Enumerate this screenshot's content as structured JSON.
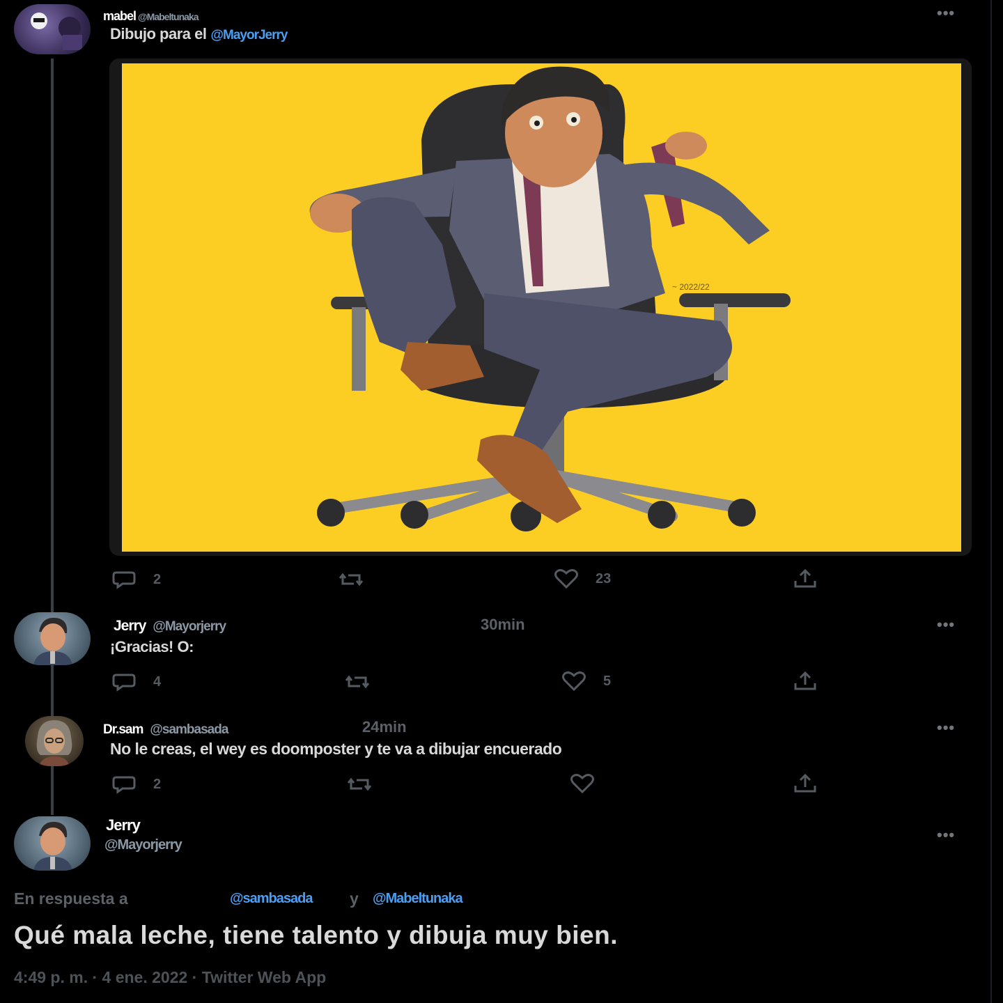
{
  "tweet1": {
    "name": "mabel",
    "handle": "@Mabeltunaka",
    "text": "Dibujo para el",
    "mention": "@MayorJerry",
    "artwork_signature": "~ 2022/22",
    "replies": "2",
    "likes": "23"
  },
  "tweet2": {
    "name": "Jerry",
    "handle": "@Mayorjerry",
    "time": "30min",
    "text": "¡Gracias! O:",
    "replies": "4",
    "likes": "5"
  },
  "tweet3": {
    "name": "Dr.sam",
    "handle": "@sambasada",
    "time": "24min",
    "text": "No le creas, el wey es doomposter y te va a dibujar encuerado",
    "replies": "2"
  },
  "tweet4": {
    "name": "Jerry",
    "handle": "@Mayorjerry",
    "reply_prefix": "En respuesta a",
    "reply_mention1": "@sambasada",
    "reply_joiner": "y",
    "reply_mention2": "@Mabeltunaka",
    "text": "Qué mala leche, tiene talento y dibuja muy bien.",
    "meta": "4:49 p. m. · 4 ene. 2022 · Twitter Web App"
  },
  "icons": {
    "more": "more-icon",
    "reply": "reply-icon",
    "retweet": "retweet-icon",
    "like": "like-icon",
    "share": "share-icon"
  },
  "colors": {
    "background": "#000000",
    "mention": "#4c9ef0",
    "artwork_background": "#fcce23"
  }
}
